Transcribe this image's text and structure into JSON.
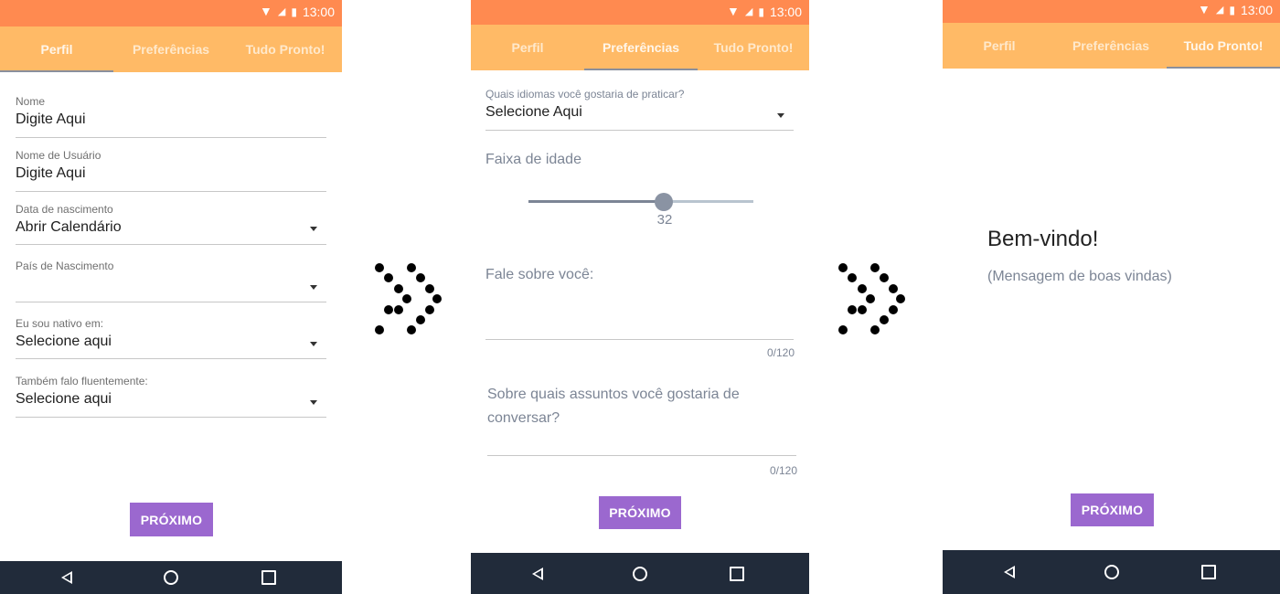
{
  "status": {
    "time": "13:00"
  },
  "tabs": [
    "Perfil",
    "Preferências",
    "Tudo Pronto!"
  ],
  "screen1": {
    "fields": [
      {
        "label": "Nome",
        "value": "Digite Aqui"
      },
      {
        "label": "Nome de Usuário",
        "value": "Digite Aqui"
      },
      {
        "label": "Data de nascimento",
        "value": "Abrir Calendário"
      },
      {
        "label": "País de Nascimento",
        "value": ""
      },
      {
        "label": "Eu sou nativo em:",
        "value": "Selecione aqui"
      },
      {
        "label": "Também falo fluentemente:",
        "value": "Selecione aqui"
      }
    ],
    "button": "PRÓXIMO"
  },
  "screen2": {
    "languages_label": "Quais idiomas você gostaria de praticar?",
    "languages_value": "Selecione Aqui",
    "age_label": "Faixa de idade",
    "age_value": "32",
    "about_label": "Fale sobre você:",
    "about_counter": "0/120",
    "topics_label": "Sobre quais assuntos você gostaria de conversar?",
    "topics_counter": "0/120",
    "button": "PRÓXIMO"
  },
  "screen3": {
    "welcome_title": "Bem-vindo!",
    "welcome_message": "(Mensagem de boas vindas)",
    "button": "PRÓXIMO"
  },
  "colors": {
    "statusbar": "#ff8a50",
    "tabbar": "#ffba66",
    "button": "#9b68cf",
    "navbar": "#212b3a"
  },
  "icons": [
    "wifi-icon",
    "signal-icon",
    "battery-icon",
    "chevron-right-dotted-icon",
    "back-icon",
    "home-icon",
    "recents-icon"
  ]
}
